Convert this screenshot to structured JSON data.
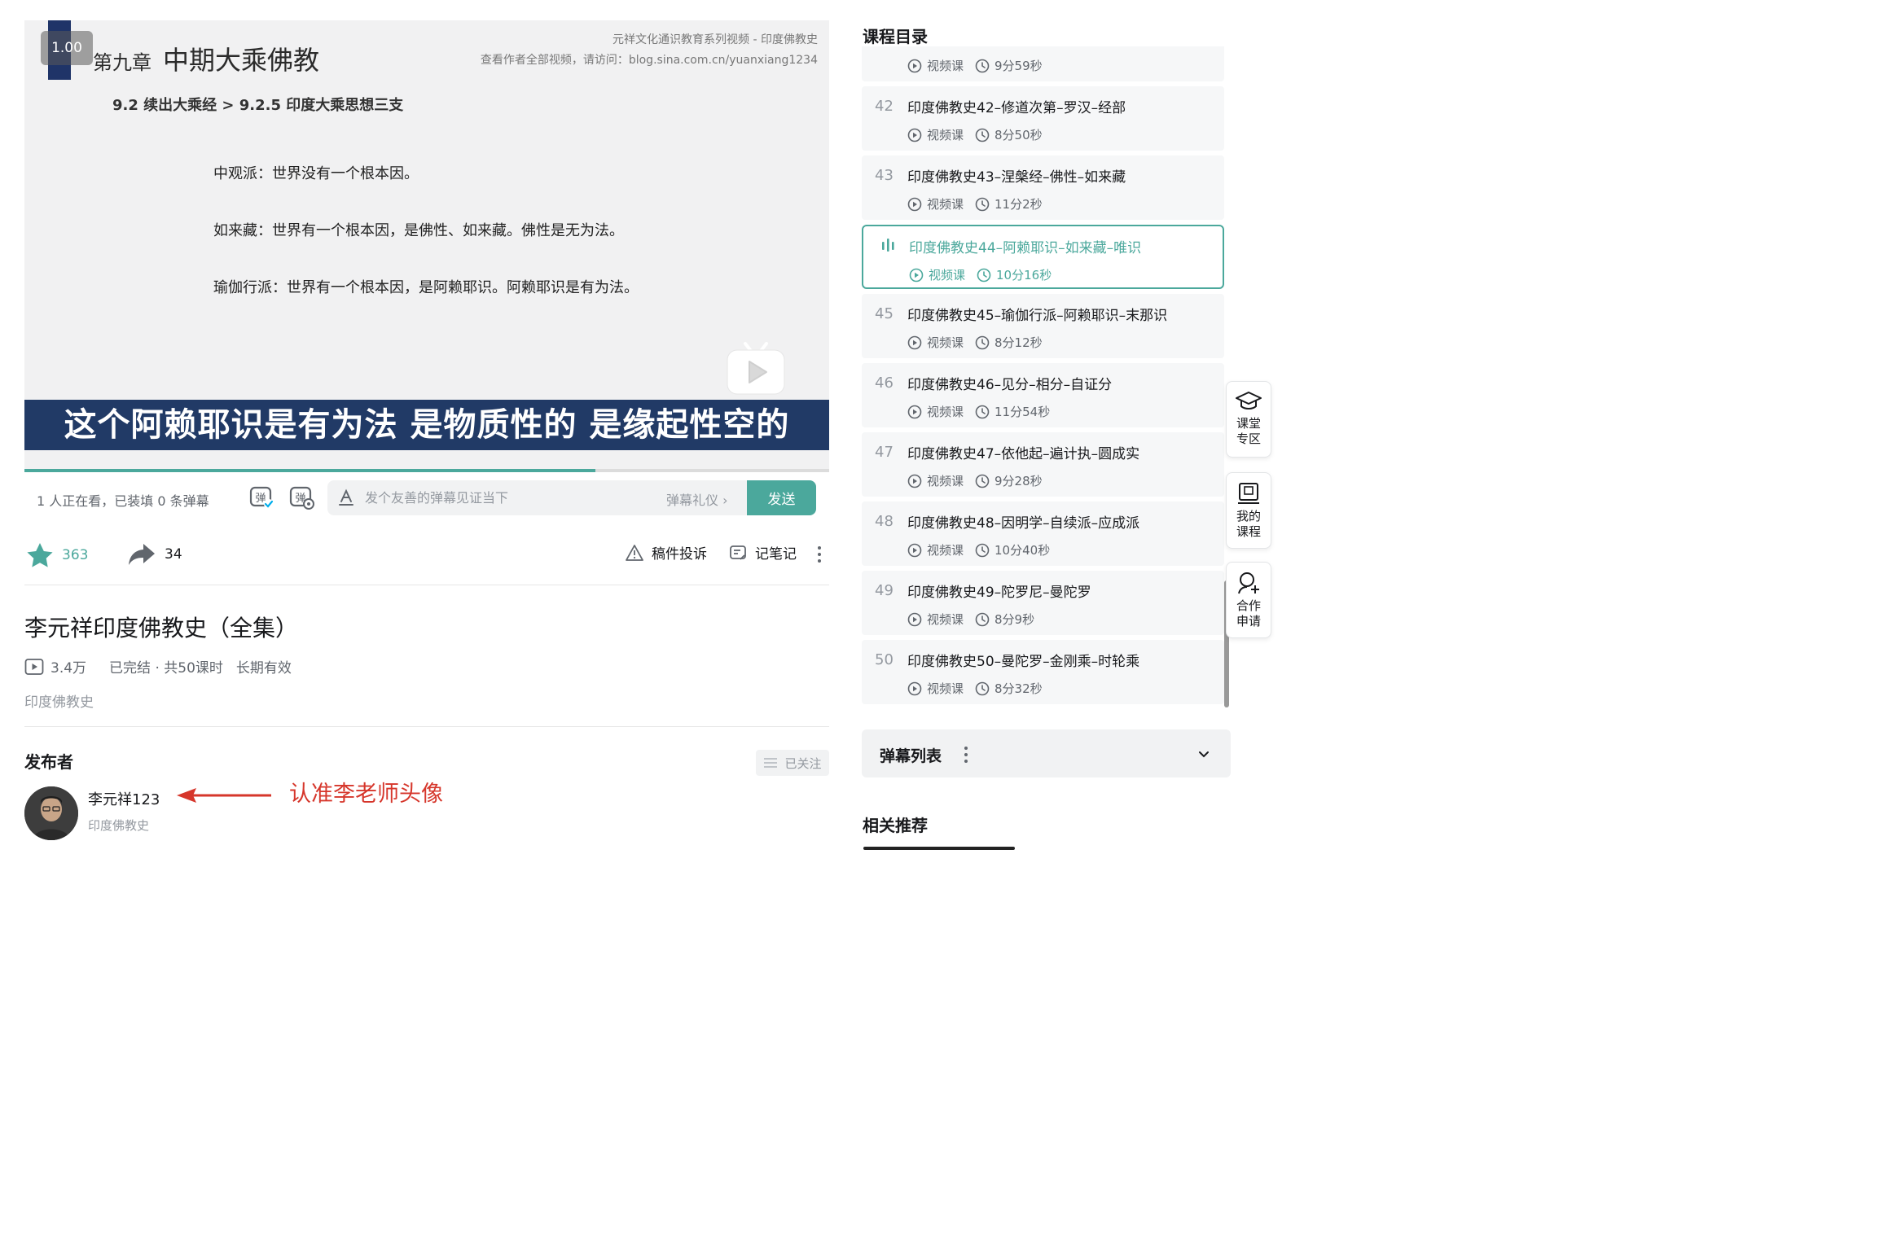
{
  "player": {
    "speed": "1.00",
    "chapter_prefix": "第九章",
    "chapter_title": "中期大乘佛教",
    "series_line1": "元祥文化通识教育系列视频 - 印度佛教史",
    "series_line2": "查看作者全部视频，请访问：blog.sina.com.cn/yuanxiang1234",
    "section": "9.2 续出大乘经 > 9.2.5 印度大乘思想三支",
    "lines": [
      "中观派：世界没有一个根本因。",
      "如来藏：世界有一个根本因，是佛性、如来藏。佛性是无为法。",
      "瑜伽行派：世界有一个根本因，是阿赖耶识。阿赖耶识是有为法。"
    ],
    "subtitle": "这个阿赖耶识是有为法 是物质性的 是缘起性空的",
    "progress": 0.71
  },
  "danmaku_bar": {
    "viewing": "1 人正在看，已装填 0 条弹幕",
    "placeholder": "发个友善的弹幕见证当下",
    "etiquette": "弹幕礼仪",
    "send": "发送"
  },
  "actions": {
    "favorites": "363",
    "shares": "34",
    "report": "稿件投诉",
    "notes": "记笔记"
  },
  "course": {
    "title": "李元祥印度佛教史（全集）",
    "views": "3.4万",
    "status": "已完结 · 共50课时",
    "validity": "长期有效",
    "tag": "印度佛教史"
  },
  "publisher": {
    "section_title": "发布者",
    "follow": "已关注",
    "name": "李元祥123",
    "subtitle": "印度佛教史",
    "annotation": "认准李老师头像"
  },
  "course_list": {
    "title": "课程目录",
    "items": [
      {
        "num": "",
        "title": "",
        "type": "视频课",
        "duration": "9分59秒",
        "active": false
      },
      {
        "num": "42",
        "title": "印度佛教史42–修道次第–罗汉–经部",
        "type": "视频课",
        "duration": "8分50秒",
        "active": false
      },
      {
        "num": "43",
        "title": "印度佛教史43–涅槃经–佛性–如来藏",
        "type": "视频课",
        "duration": "11分2秒",
        "active": false
      },
      {
        "num": "",
        "title": "印度佛教史44–阿赖耶识–如来藏–唯识",
        "type": "视频课",
        "duration": "10分16秒",
        "active": true
      },
      {
        "num": "45",
        "title": "印度佛教史45–瑜伽行派–阿赖耶识–末那识",
        "type": "视频课",
        "duration": "8分12秒",
        "active": false
      },
      {
        "num": "46",
        "title": "印度佛教史46–见分–相分–自证分",
        "type": "视频课",
        "duration": "11分54秒",
        "active": false
      },
      {
        "num": "47",
        "title": "印度佛教史47–依他起–遍计执–圆成实",
        "type": "视频课",
        "duration": "9分28秒",
        "active": false
      },
      {
        "num": "48",
        "title": "印度佛教史48–因明学–自续派–应成派",
        "type": "视频课",
        "duration": "10分40秒",
        "active": false
      },
      {
        "num": "49",
        "title": "印度佛教史49–陀罗尼–曼陀罗",
        "type": "视频课",
        "duration": "8分9秒",
        "active": false
      },
      {
        "num": "50",
        "title": "印度佛教史50–曼陀罗–金刚乘–时轮乘",
        "type": "视频课",
        "duration": "8分32秒",
        "active": false
      }
    ]
  },
  "side_buttons": [
    {
      "label": "课堂专区",
      "icon": "graduation-cap-icon"
    },
    {
      "label": "我的课程",
      "icon": "my-course-icon"
    },
    {
      "label": "合作申请",
      "icon": "add-user-icon"
    }
  ],
  "danmaku_list": {
    "title": "弹幕列表"
  },
  "related": {
    "title": "相关推荐"
  },
  "colors": {
    "accent": "#4ba89c",
    "annotation": "#d6362b",
    "subtitle_band": "#213a66"
  }
}
